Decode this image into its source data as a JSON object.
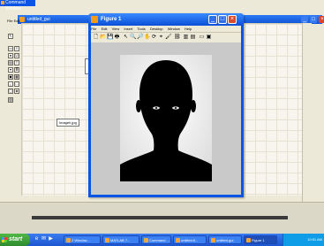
{
  "command_window": {
    "title": "Command Window"
  },
  "guide_window": {
    "title": "untitled_gui",
    "menubar": {
      "file": "File",
      "edit": "Edit"
    },
    "static_text": "Imageh.jpg",
    "palette": [
      "sel",
      "push",
      "radio",
      "toggle",
      "slide",
      "check",
      "edit",
      "static",
      "popup",
      "list",
      "table",
      "axes",
      "panel",
      "group",
      "activex",
      "grid"
    ]
  },
  "figure_window": {
    "title": "Figure 1",
    "menu": [
      "File",
      "Edit",
      "View",
      "Insert",
      "Tools",
      "Desktop",
      "Window",
      "Help"
    ]
  },
  "taskbar": {
    "start_label": "start",
    "items": [
      "2 Window...",
      "MATLAB 7...",
      "Command ...",
      "untitled.fi...",
      "untitled.gui",
      "Figure 1"
    ],
    "clock": "10:51 AM"
  },
  "colors": {
    "titlebar_blue": "#0a54e6",
    "taskbar_blue": "#2458d4",
    "start_green": "#3ea23a",
    "figure_bg": "#c9c9c9"
  }
}
